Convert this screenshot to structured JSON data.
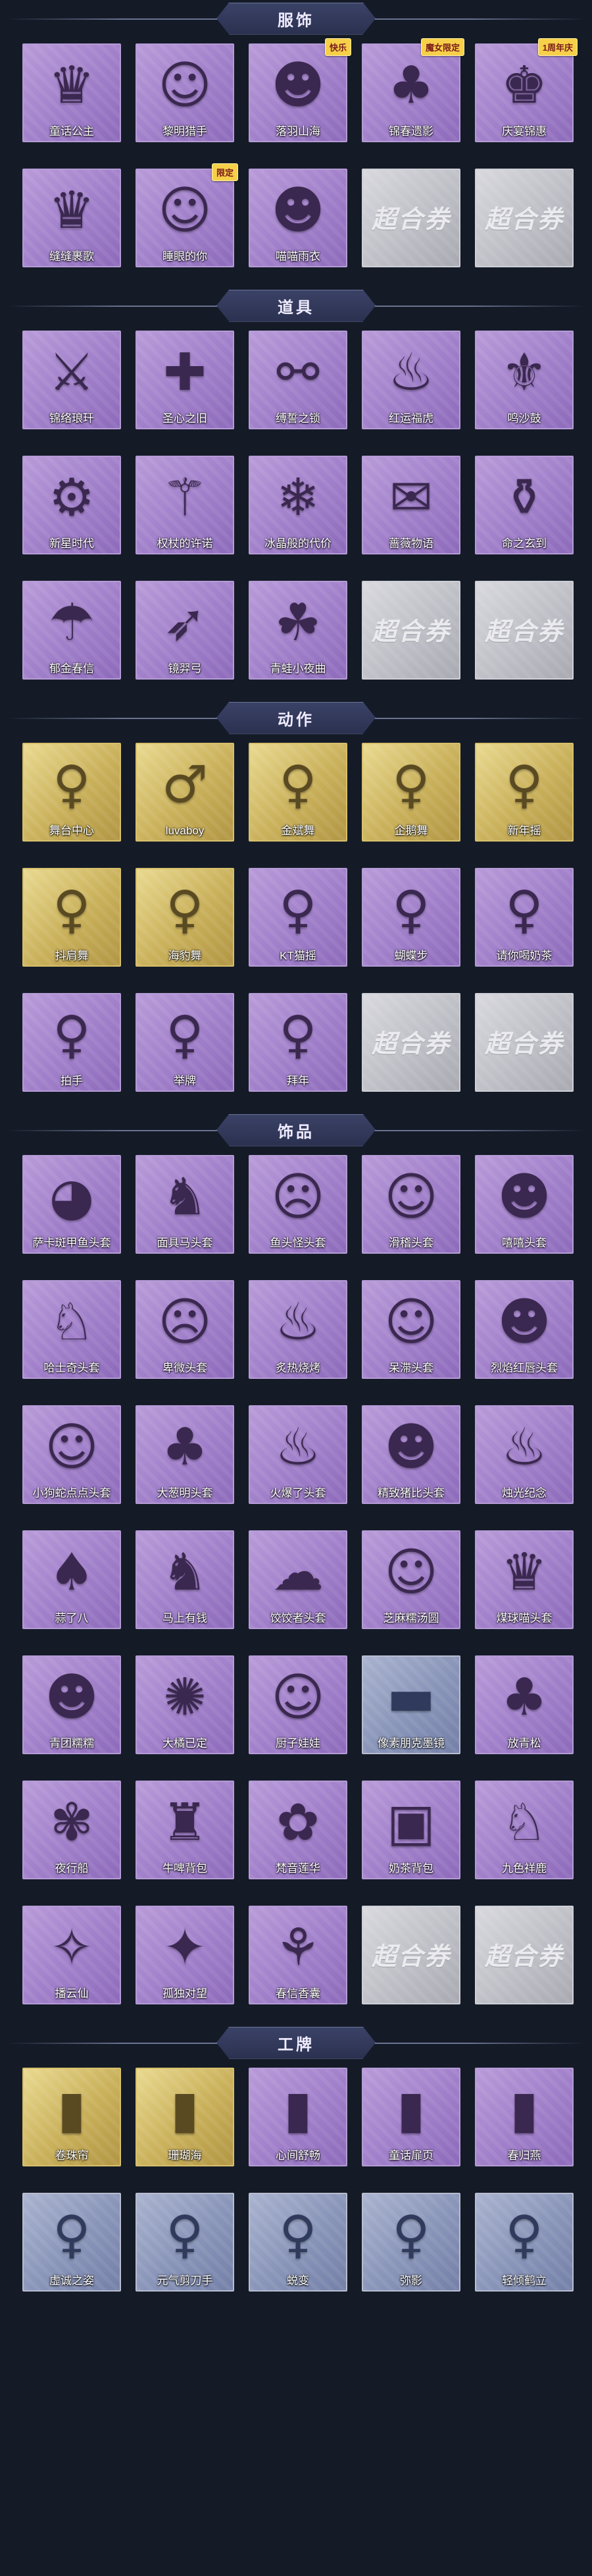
{
  "sections": [
    {
      "title": "服饰",
      "items": [
        {
          "label": "童话公主",
          "icon": "♛",
          "style": "purple"
        },
        {
          "label": "黎明猎手",
          "icon": "☺",
          "style": "purple"
        },
        {
          "label": "落羽山海",
          "icon": "☻",
          "style": "purple",
          "badge": "快乐"
        },
        {
          "label": "锦春遗影",
          "icon": "♣",
          "style": "purple",
          "badge": "魔女限定"
        },
        {
          "label": "庆宴锦惠",
          "icon": "♚",
          "style": "purple",
          "badge": "1周年庆"
        },
        {
          "label": "缝缝裹歌",
          "icon": "♛",
          "style": "purple"
        },
        {
          "label": "睡眼的你",
          "icon": "☺",
          "style": "purple",
          "badge": "限定"
        },
        {
          "label": "喵喵雨衣",
          "icon": "☻",
          "style": "purple"
        },
        {
          "label": "",
          "blank": "超合券",
          "style": "blank"
        },
        {
          "label": "",
          "blank": "超合券",
          "style": "blank"
        }
      ]
    },
    {
      "title": "道具",
      "items": [
        {
          "label": "锦络琅玕",
          "icon": "⚔",
          "style": "purple"
        },
        {
          "label": "圣心之旧",
          "icon": "✚",
          "style": "purple"
        },
        {
          "label": "缚誓之锁",
          "icon": "⚯",
          "style": "purple"
        },
        {
          "label": "红运福虎",
          "icon": "♨",
          "style": "purple"
        },
        {
          "label": "鸣沙鼓",
          "icon": "⚜",
          "style": "purple"
        },
        {
          "label": "新星时代",
          "icon": "⚙",
          "style": "purple"
        },
        {
          "label": "权杖的许诺",
          "icon": "⚚",
          "style": "purple"
        },
        {
          "label": "冰晶般的代价",
          "icon": "❄",
          "style": "purple"
        },
        {
          "label": "蔷薇物语",
          "icon": "✉",
          "style": "purple"
        },
        {
          "label": "命之玄到",
          "icon": "⚱",
          "style": "purple"
        },
        {
          "label": "郁金春信",
          "icon": "☂",
          "style": "purple"
        },
        {
          "label": "镜羿弓",
          "icon": "➶",
          "style": "purple"
        },
        {
          "label": "青蛙小夜曲",
          "icon": "☘",
          "style": "purple"
        },
        {
          "label": "",
          "blank": "超合券",
          "style": "blank"
        },
        {
          "label": "",
          "blank": "超合券",
          "style": "blank"
        }
      ]
    },
    {
      "title": "动作",
      "items": [
        {
          "label": "舞台中心",
          "icon": "♀",
          "style": "gold"
        },
        {
          "label": "luvaboy",
          "icon": "♂",
          "style": "gold"
        },
        {
          "label": "金斌舞",
          "icon": "♀",
          "style": "gold"
        },
        {
          "label": "企鹅舞",
          "icon": "♀",
          "style": "gold"
        },
        {
          "label": "新年摇",
          "icon": "♀",
          "style": "gold"
        },
        {
          "label": "抖肩舞",
          "icon": "♀",
          "style": "gold"
        },
        {
          "label": "海豹舞",
          "icon": "♀",
          "style": "gold"
        },
        {
          "label": "KT猫摇",
          "icon": "♀",
          "style": "purple"
        },
        {
          "label": "蝴蝶步",
          "icon": "♀",
          "style": "purple"
        },
        {
          "label": "请你喝奶茶",
          "icon": "♀",
          "style": "purple"
        },
        {
          "label": "拍手",
          "icon": "♀",
          "style": "purple"
        },
        {
          "label": "举牌",
          "icon": "♀",
          "style": "purple"
        },
        {
          "label": "拜年",
          "icon": "♀",
          "style": "purple"
        },
        {
          "label": "",
          "blank": "超合券",
          "style": "blank"
        },
        {
          "label": "",
          "blank": "超合券",
          "style": "blank"
        }
      ]
    },
    {
      "title": "饰品",
      "items": [
        {
          "label": "萨卡斑甲鱼头套",
          "icon": "◕",
          "style": "purple"
        },
        {
          "label": "面具马头套",
          "icon": "♞",
          "style": "purple"
        },
        {
          "label": "鱼头怪头套",
          "icon": "☹",
          "style": "purple"
        },
        {
          "label": "滑稽头套",
          "icon": "☺",
          "style": "purple"
        },
        {
          "label": "嘻嘻头套",
          "icon": "☻",
          "style": "purple"
        },
        {
          "label": "哈士奇头套",
          "icon": "♘",
          "style": "purple"
        },
        {
          "label": "卑微头套",
          "icon": "☹",
          "style": "purple"
        },
        {
          "label": "炙热烧烤",
          "icon": "♨",
          "style": "purple"
        },
        {
          "label": "呆滞头套",
          "icon": "☺",
          "style": "purple"
        },
        {
          "label": "烈焰红唇头套",
          "icon": "☻",
          "style": "purple"
        },
        {
          "label": "小狗蛇点点头套",
          "icon": "☺",
          "style": "purple"
        },
        {
          "label": "大葱明头套",
          "icon": "♣",
          "style": "purple"
        },
        {
          "label": "火爆了头套",
          "icon": "♨",
          "style": "purple"
        },
        {
          "label": "精致猪比头套",
          "icon": "☻",
          "style": "purple"
        },
        {
          "label": "烛光纪念",
          "icon": "♨",
          "style": "purple"
        },
        {
          "label": "蒜了八",
          "icon": "♠",
          "style": "purple"
        },
        {
          "label": "马上有钱",
          "icon": "♞",
          "style": "purple"
        },
        {
          "label": "饺饺者头套",
          "icon": "☁",
          "style": "purple"
        },
        {
          "label": "芝麻糯汤圆",
          "icon": "☺",
          "style": "purple"
        },
        {
          "label": "煤球喵头套",
          "icon": "♛",
          "style": "purple"
        },
        {
          "label": "青团糯糯",
          "icon": "☻",
          "style": "purple"
        },
        {
          "label": "大橘已定",
          "icon": "✺",
          "style": "purple"
        },
        {
          "label": "厨子娃娃",
          "icon": "☺",
          "style": "purple"
        },
        {
          "label": "像素朋克墨镜",
          "icon": "▬",
          "style": "bluegray"
        },
        {
          "label": "放青松",
          "icon": "♣",
          "style": "purple"
        },
        {
          "label": "夜行船",
          "icon": "✾",
          "style": "purple"
        },
        {
          "label": "牛啤背包",
          "icon": "♜",
          "style": "purple"
        },
        {
          "label": "梵音莲华",
          "icon": "✿",
          "style": "purple"
        },
        {
          "label": "奶茶背包",
          "icon": "▣",
          "style": "purple"
        },
        {
          "label": "九色祥鹿",
          "icon": "♘",
          "style": "purple"
        },
        {
          "label": "播云仙",
          "icon": "✧",
          "style": "purple"
        },
        {
          "label": "孤独对望",
          "icon": "✦",
          "style": "purple"
        },
        {
          "label": "春信香囊",
          "icon": "⚘",
          "style": "purple"
        },
        {
          "label": "",
          "blank": "超合券",
          "style": "blank"
        },
        {
          "label": "",
          "blank": "超合券",
          "style": "blank"
        }
      ]
    },
    {
      "title": "工牌",
      "items": [
        {
          "label": "卷珠帘",
          "icon": "▮",
          "style": "gold"
        },
        {
          "label": "珊瑚海",
          "icon": "▮",
          "style": "gold"
        },
        {
          "label": "心间舒畅",
          "icon": "▮",
          "style": "purple"
        },
        {
          "label": "童话扉页",
          "icon": "▮",
          "style": "purple"
        },
        {
          "label": "春归燕",
          "icon": "▮",
          "style": "purple"
        },
        {
          "label": "虚诚之姿",
          "icon": "♀",
          "style": "bluegray"
        },
        {
          "label": "元气剪刀手",
          "icon": "♀",
          "style": "bluegray"
        },
        {
          "label": "蜕变",
          "icon": "♀",
          "style": "bluegray"
        },
        {
          "label": "弥影",
          "icon": "♀",
          "style": "bluegray"
        },
        {
          "label": "轻倾鹤立",
          "icon": "♀",
          "style": "bluegray"
        }
      ]
    }
  ]
}
